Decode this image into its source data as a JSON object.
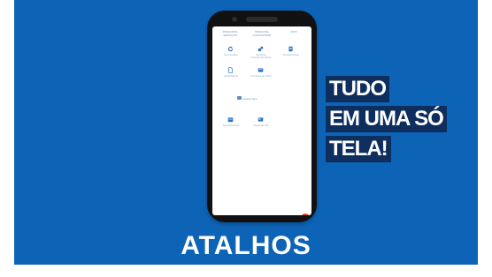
{
  "screen": {
    "tabs": [
      "PRINCIPAIS SERVIÇOS",
      "PESQUISA CONSUMIDOR",
      "MAIS"
    ],
    "icons": [
      {
        "name": "refresh-icon",
        "label": "Renovação"
      },
      {
        "name": "gear-link-icon",
        "label": "Serviços Complementares"
      },
      {
        "name": "document-icon",
        "label": "Reclamações"
      },
      {
        "name": "file-icon",
        "label": "Solicitações"
      },
      {
        "name": "wifi-icon",
        "label": "Consulta de Wi-Fi"
      },
      {
        "name": "calendar-icon",
        "label": "Agendamento"
      },
      {
        "name": "card-icon",
        "label": "Segunda Via"
      }
    ],
    "center_link": "Acesse Aqui",
    "icon_color": "#2f6fbf",
    "fab_color": "#e8452b"
  },
  "tagline": [
    "TUDO",
    "EM UMA SÓ",
    "TELA!"
  ],
  "headline": "ATALHOS",
  "colors": {
    "background": "#0d63b6",
    "tag_bg": "#0e2f5e",
    "text": "#ffffff"
  }
}
